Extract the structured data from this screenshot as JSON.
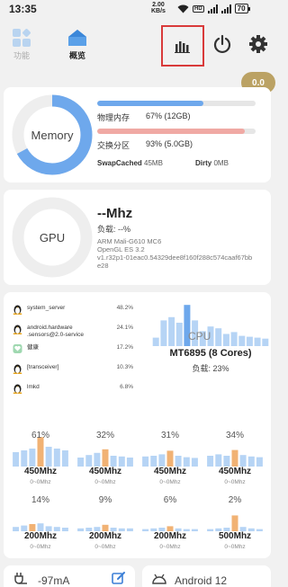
{
  "status_bar": {
    "time": "13:35",
    "speed_value": "2.00",
    "speed_unit": "KB/s",
    "hd_label": "HD",
    "battery": "70"
  },
  "nav": {
    "tabs": [
      {
        "label": "功能",
        "active": false
      },
      {
        "label": "概览",
        "active": true
      }
    ]
  },
  "badge": "0.0",
  "memory": {
    "ring_label": "Memory",
    "ring_fill": 0.67,
    "ram_label": "物理内存",
    "ram_value": "67% (12GB)",
    "ram_fill": 0.67,
    "swap_label": "交换分区",
    "swap_value": "93% (5.0GB)",
    "swap_fill": 0.93,
    "swap_cached_label": "SwapCached",
    "swap_cached_value": "45MB",
    "dirty_label": "Dirty",
    "dirty_value": "0MB"
  },
  "gpu": {
    "ring_label": "GPU",
    "freq": "--Mhz",
    "load": "负载: --%",
    "info_line1": "ARM Mali-G610 MC6",
    "info_line2": "OpenGL ES 3.2",
    "info_line3": "v1.r32p1-01eac0.54329dee8f160f288c574caaf67bb",
    "info_line4": "e28"
  },
  "processes": [
    {
      "name": "system_server",
      "percent": "48.2%",
      "icon": "linux-penguin-icon"
    },
    {
      "name": "android.hardware\n.sensors@2.0-service",
      "percent": "24.1%",
      "icon": "linux-penguin-icon"
    },
    {
      "name": "健康",
      "percent": "17.2%",
      "icon": "app-icon"
    },
    {
      "name": "[transceiver]",
      "percent": "10.3%",
      "icon": "linux-penguin-icon"
    },
    {
      "name": "lmkd",
      "percent": "6.8%",
      "icon": "linux-penguin-icon"
    }
  ],
  "cpu": {
    "chart_title": "CPU",
    "model": "MT6895 (8 Cores)",
    "load": "负载:  23%",
    "overall_bars": [
      0.18,
      0.55,
      0.62,
      0.5,
      0.88,
      0.55,
      0.32,
      0.42,
      0.38,
      0.26,
      0.3,
      0.22,
      0.2,
      0.18,
      0.16
    ],
    "cores": [
      {
        "percent": "61%",
        "freq": "450Mhz",
        "range": "0~0Mhz",
        "bars": [
          0.4,
          0.45,
          0.5,
          0.82,
          0.55,
          0.5,
          0.45
        ],
        "hi": 3
      },
      {
        "percent": "32%",
        "freq": "450Mhz",
        "range": "0~0Mhz",
        "bars": [
          0.25,
          0.32,
          0.38,
          0.48,
          0.3,
          0.28,
          0.25
        ],
        "hi": 3
      },
      {
        "percent": "31%",
        "freq": "450Mhz",
        "range": "0~0Mhz",
        "bars": [
          0.28,
          0.3,
          0.34,
          0.44,
          0.3,
          0.26,
          0.24
        ],
        "hi": 3
      },
      {
        "percent": "34%",
        "freq": "450Mhz",
        "range": "0~0Mhz",
        "bars": [
          0.3,
          0.34,
          0.3,
          0.46,
          0.32,
          0.28,
          0.26
        ],
        "hi": 3
      },
      {
        "percent": "14%",
        "freq": "200Mhz",
        "range": "0~0Mhz",
        "bars": [
          0.12,
          0.16,
          0.2,
          0.22,
          0.14,
          0.12,
          0.1
        ],
        "hi": 2
      },
      {
        "percent": "9%",
        "freq": "200Mhz",
        "range": "0~0Mhz",
        "bars": [
          0.08,
          0.1,
          0.12,
          0.18,
          0.1,
          0.08,
          0.08
        ],
        "hi": 3
      },
      {
        "percent": "6%",
        "freq": "200Mhz",
        "range": "0~0Mhz",
        "bars": [
          0.06,
          0.08,
          0.1,
          0.14,
          0.08,
          0.06,
          0.06
        ],
        "hi": 3
      },
      {
        "percent": "2%",
        "freq": "500Mhz",
        "range": "0~0Mhz",
        "bars": [
          0.06,
          0.08,
          0.1,
          0.44,
          0.12,
          0.08,
          0.06
        ],
        "hi": 3
      }
    ]
  },
  "bottom": {
    "current": "-97mA",
    "android": "Android 12"
  },
  "colors": {
    "accent_blue": "#6ea8ec",
    "light_blue": "#b6d4f5",
    "swap_red": "#f0a9a4",
    "highlight_orange": "#f1b274",
    "badge_gold": "#bba264",
    "annotation_red": "#d93a3a"
  }
}
